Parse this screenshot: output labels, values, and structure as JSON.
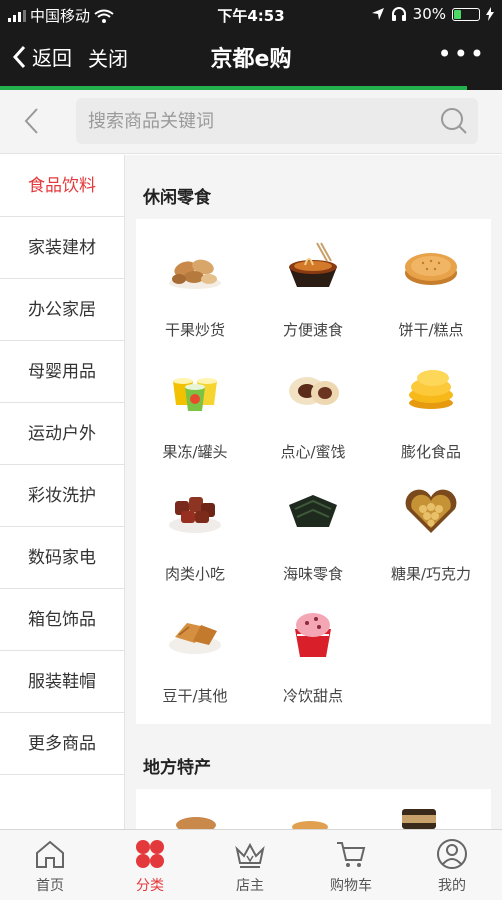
{
  "status_bar": {
    "carrier": "中国移动",
    "time": "下午4:53",
    "battery": "30%",
    "battery_level": 0.3
  },
  "navbar": {
    "back_label": "返回",
    "close_label": "关闭",
    "title": "京都e购",
    "more_label": "•••",
    "load_progress": 0.93
  },
  "search": {
    "placeholder": "搜索商品关键词"
  },
  "sidebar": {
    "items": [
      {
        "label": "食品饮料",
        "active": true
      },
      {
        "label": "家装建材"
      },
      {
        "label": "办公家居"
      },
      {
        "label": "母婴用品"
      },
      {
        "label": "运动户外"
      },
      {
        "label": "彩妆洗护"
      },
      {
        "label": "数码家电"
      },
      {
        "label": "箱包饰品"
      },
      {
        "label": "服装鞋帽"
      },
      {
        "label": "更多商品"
      }
    ]
  },
  "sections": [
    {
      "title": "休闲零食",
      "items": [
        {
          "label": "干果炒货",
          "icon": "nuts-icon"
        },
        {
          "label": "方便速食",
          "icon": "instant-noodles-icon"
        },
        {
          "label": "饼干/糕点",
          "icon": "biscuit-icon"
        },
        {
          "label": "果冻/罐头",
          "icon": "jelly-cups-icon"
        },
        {
          "label": "点心/蜜饯",
          "icon": "pastry-icon"
        },
        {
          "label": "膨化食品",
          "icon": "chips-icon"
        },
        {
          "label": "肉类小吃",
          "icon": "meat-snack-icon"
        },
        {
          "label": "海味零食",
          "icon": "seaweed-icon"
        },
        {
          "label": "糖果/巧克力",
          "icon": "chocolate-box-icon"
        },
        {
          "label": "豆干/其他",
          "icon": "tofu-icon"
        },
        {
          "label": "冷饮甜点",
          "icon": "ice-cream-icon"
        }
      ]
    },
    {
      "title": "地方特产",
      "items": []
    }
  ],
  "tabbar": {
    "tabs": [
      {
        "label": "首页",
        "icon": "home-icon"
      },
      {
        "label": "分类",
        "icon": "category-icon",
        "active": true
      },
      {
        "label": "店主",
        "icon": "crown-icon"
      },
      {
        "label": "购物车",
        "icon": "cart-icon"
      },
      {
        "label": "我的",
        "icon": "user-icon"
      }
    ]
  },
  "colors": {
    "accent": "#e4393c",
    "progress": "#22b14c",
    "header_bg": "#1a1a1a"
  }
}
